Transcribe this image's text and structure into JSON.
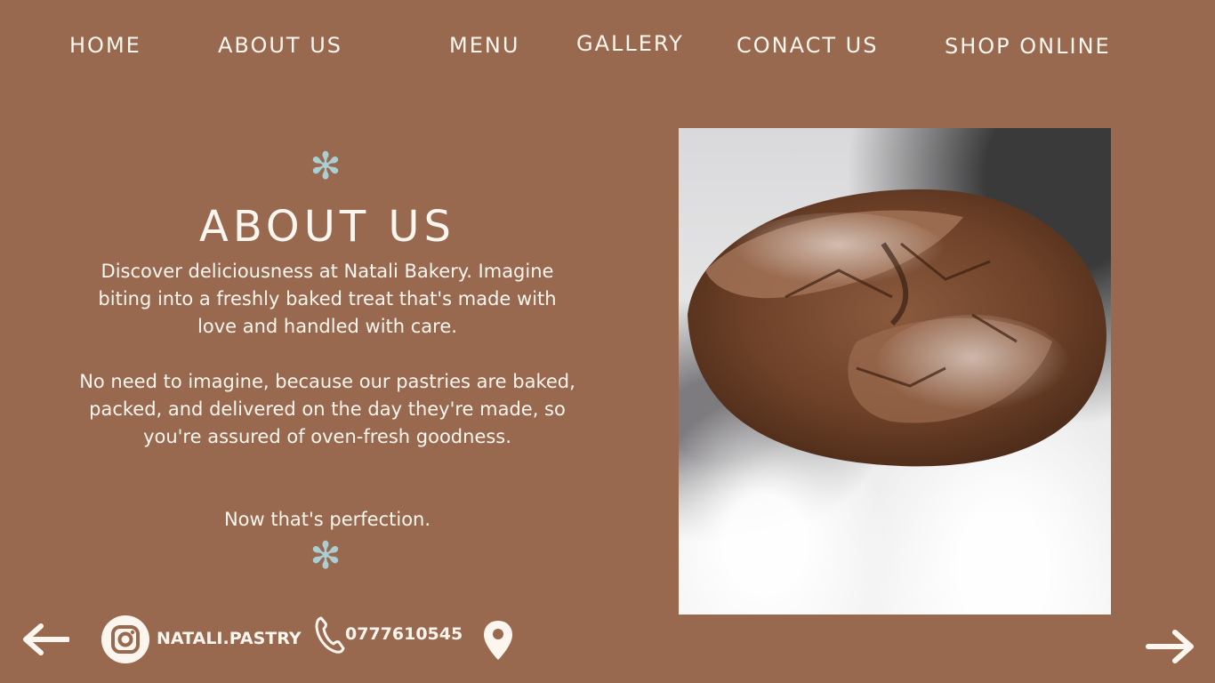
{
  "nav": {
    "home": "HOME",
    "about": "ABOUT US",
    "menu": "MENU",
    "gallery": "GALLERY",
    "contact": "CONACT US",
    "shop": "SHOP ONLINE"
  },
  "about": {
    "asterisk": "✻",
    "title": "ABOUT US",
    "paragraph_1": "Discover deliciousness at Natali Bakery. Imagine biting into a freshly baked treat that's made with love and handled with care.",
    "paragraph_2": "No need to imagine, because our pastries are baked, packed, and delivered on the day they're made, so you're assured of oven-fresh goodness.",
    "paragraph_3": "Now that's perfection."
  },
  "footer": {
    "instagram_handle": "NATALI.PASTRY",
    "phone": "0777610545",
    "icons": [
      "arrow-left-icon",
      "instagram-icon",
      "phone-icon",
      "location-pin-icon",
      "arrow-right-icon"
    ]
  },
  "colors": {
    "background": "#98684f",
    "text": "#fdf6ee",
    "accent": "#a9cfd3"
  }
}
